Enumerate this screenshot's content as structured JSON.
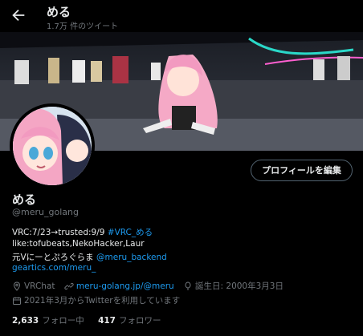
{
  "header": {
    "title": "める",
    "tweet_count": "1.7万 件のツイート"
  },
  "profile": {
    "display_name": "める",
    "handle": "@meru_golang",
    "edit_label": "プロフィールを編集",
    "bio": {
      "line1_text": "VRC:7/23→trusted:9/9 ",
      "line1_link": "#VRC_める",
      "line2": "like:tofubeats,NekoHacker,Laur",
      "line3_text": "元Vにーとぷろぐらま ",
      "line3_link": "@meru_backend",
      "line4_link": "geartics.com/meru_"
    },
    "location": "VRChat",
    "website": "meru-golang.jp/@meru",
    "birthday": "誕生日: 2000年3月3日",
    "joined": "2021年3月からTwitterを利用しています",
    "following_count": "2,633",
    "following_label": "フォロー中",
    "followers_count": "417",
    "followers_label": "フォロワー"
  },
  "colors": {
    "accent": "#1d9bf0",
    "background": "#000000",
    "muted": "#71767b"
  }
}
